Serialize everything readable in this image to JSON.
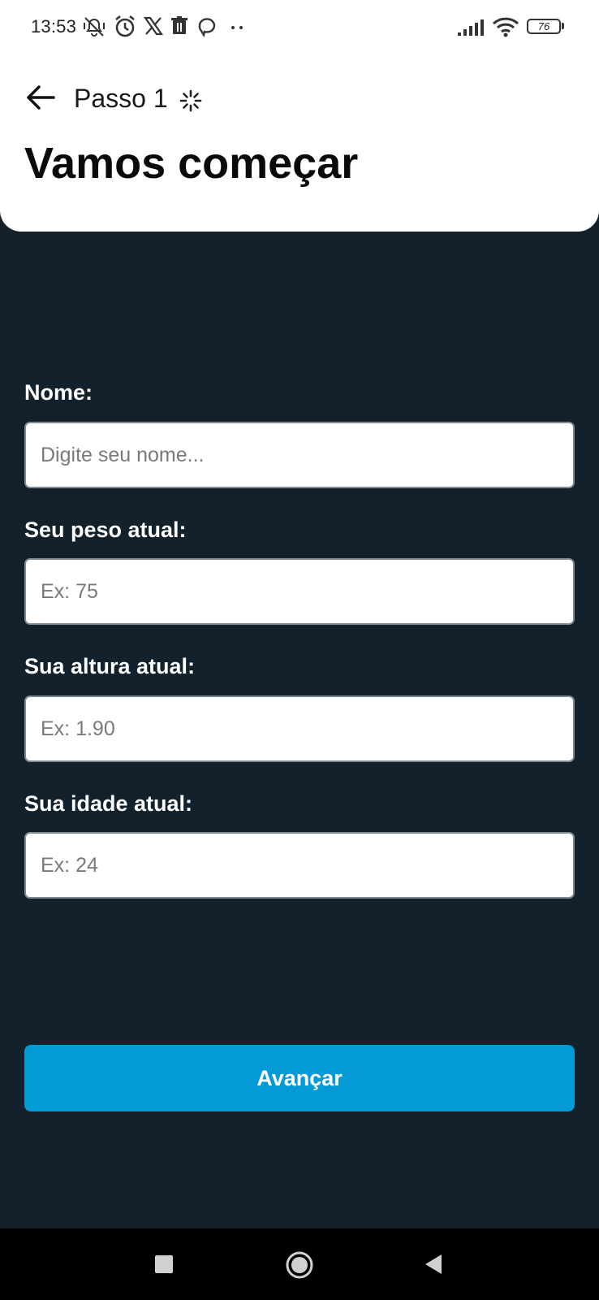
{
  "status_bar": {
    "time": "13:53",
    "battery": "76",
    "icons": [
      "vibrate-off-icon",
      "alarm-icon",
      "x-app-icon",
      "trash-icon",
      "chat-icon",
      "more-dots-icon",
      "signal-icon",
      "wifi-icon",
      "battery-icon"
    ]
  },
  "header": {
    "step": "Passo 1",
    "title": "Vamos começar",
    "back_icon": "arrow-left-icon",
    "loading_icon": "spinner-icon"
  },
  "form": {
    "name": {
      "label": "Nome:",
      "placeholder": "Digite seu nome...",
      "value": ""
    },
    "weight": {
      "label": "Seu peso atual:",
      "placeholder": "Ex: 75",
      "value": ""
    },
    "height": {
      "label": "Sua altura atual:",
      "placeholder": "Ex: 1.90",
      "value": ""
    },
    "age": {
      "label": "Sua idade atual:",
      "placeholder": "Ex: 24",
      "value": ""
    }
  },
  "actions": {
    "advance_label": "Avançar"
  },
  "colors": {
    "background": "#12212c",
    "header": "#ffffff",
    "primary_button": "#049ad5",
    "nav_bar": "#000000"
  },
  "nav": {
    "icons": [
      "recents-square-icon",
      "home-circle-icon",
      "back-triangle-icon"
    ]
  }
}
